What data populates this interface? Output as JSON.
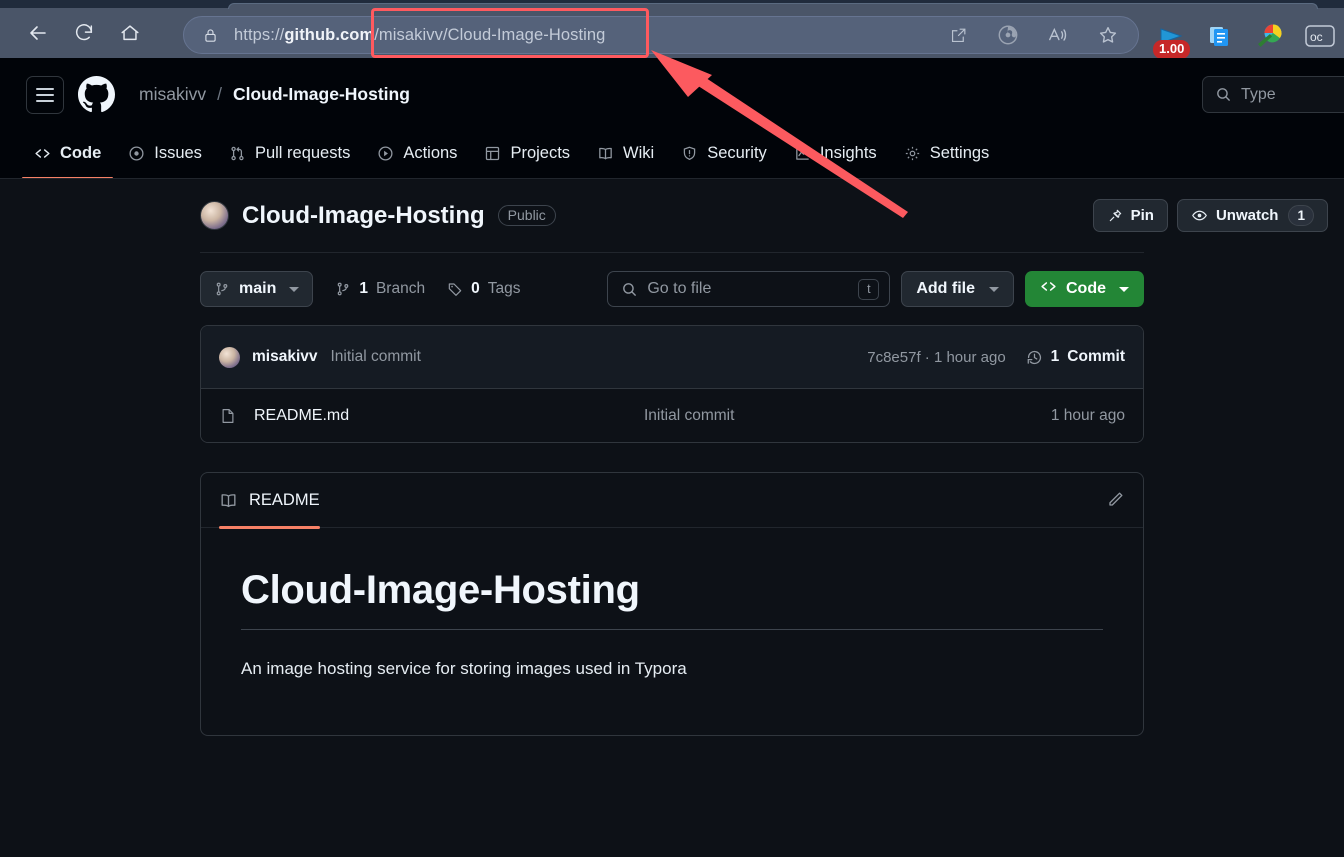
{
  "browser": {
    "back_label": "back-arrow",
    "reload_label": "reload",
    "home_label": "home",
    "url_prefix": "https://",
    "url_bold": "github.com",
    "url_rest": "/misakivv/Cloud-Image-Hosting",
    "badge_value": "1.00"
  },
  "github": {
    "header": {
      "owner": "misakivv",
      "separator": "/",
      "repo": "Cloud-Image-Hosting",
      "search_placeholder": "Type"
    },
    "nav_tabs": [
      {
        "label": "Code",
        "icon": "code-icon",
        "active": true
      },
      {
        "label": "Issues",
        "icon": "issue-opened-icon",
        "active": false
      },
      {
        "label": "Pull requests",
        "icon": "git-pull-request-icon",
        "active": false
      },
      {
        "label": "Actions",
        "icon": "play-icon",
        "active": false
      },
      {
        "label": "Projects",
        "icon": "table-icon",
        "active": false
      },
      {
        "label": "Wiki",
        "icon": "book-icon",
        "active": false
      },
      {
        "label": "Security",
        "icon": "shield-icon",
        "active": false
      },
      {
        "label": "Insights",
        "icon": "graph-icon",
        "active": false
      },
      {
        "label": "Settings",
        "icon": "gear-icon",
        "active": false
      }
    ],
    "repo": {
      "name": "Cloud-Image-Hosting",
      "visibility": "Public",
      "pin_label": "Pin",
      "watch_label": "Unwatch",
      "watch_count": "1"
    },
    "file_nav": {
      "branch": "main",
      "branch_count": "1",
      "branch_word": "Branch",
      "tag_count": "0",
      "tag_word": "Tags",
      "goto_file_placeholder": "Go to file",
      "goto_file_kbd": "t",
      "add_file_label": "Add file",
      "code_label": "Code"
    },
    "latest_commit": {
      "author": "misakivv",
      "message": "Initial commit",
      "meta": "7c8e57f · 1 hour ago",
      "count_number": "1",
      "count_label": "Commit"
    },
    "files": [
      {
        "name": "README.md",
        "commit": "Initial commit",
        "age": "1 hour ago",
        "icon": "file-icon"
      }
    ],
    "readme": {
      "tab_label": "README",
      "heading": "Cloud-Image-Hosting",
      "paragraph": "An image hosting service for storing images used in Typora"
    }
  },
  "colors": {
    "page_bg": "#0d1117",
    "header_bg": "#010409",
    "border": "#30363d",
    "accent_green": "#238636",
    "accent_orange": "#f78166",
    "annotation_red": "#ff5a5f",
    "browser_chrome": "#4a5568"
  }
}
